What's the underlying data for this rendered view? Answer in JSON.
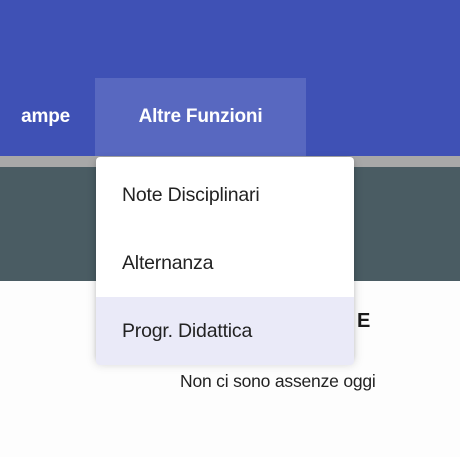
{
  "navbar": {
    "items": [
      {
        "label": "ampe"
      },
      {
        "label": "Altre Funzioni"
      }
    ]
  },
  "dropdown": {
    "items": [
      {
        "label": "Note Disciplinari"
      },
      {
        "label": "Alternanza"
      },
      {
        "label": "Progr. Didattica"
      }
    ]
  },
  "content": {
    "heading_fragment": "E",
    "empty_message": "Non ci sono assenze oggi"
  },
  "colors": {
    "navbar": "#3f51b5",
    "navbar_active": "#5868c0",
    "band": "#4a5c63",
    "menu_highlight": "#eaeaf8"
  }
}
